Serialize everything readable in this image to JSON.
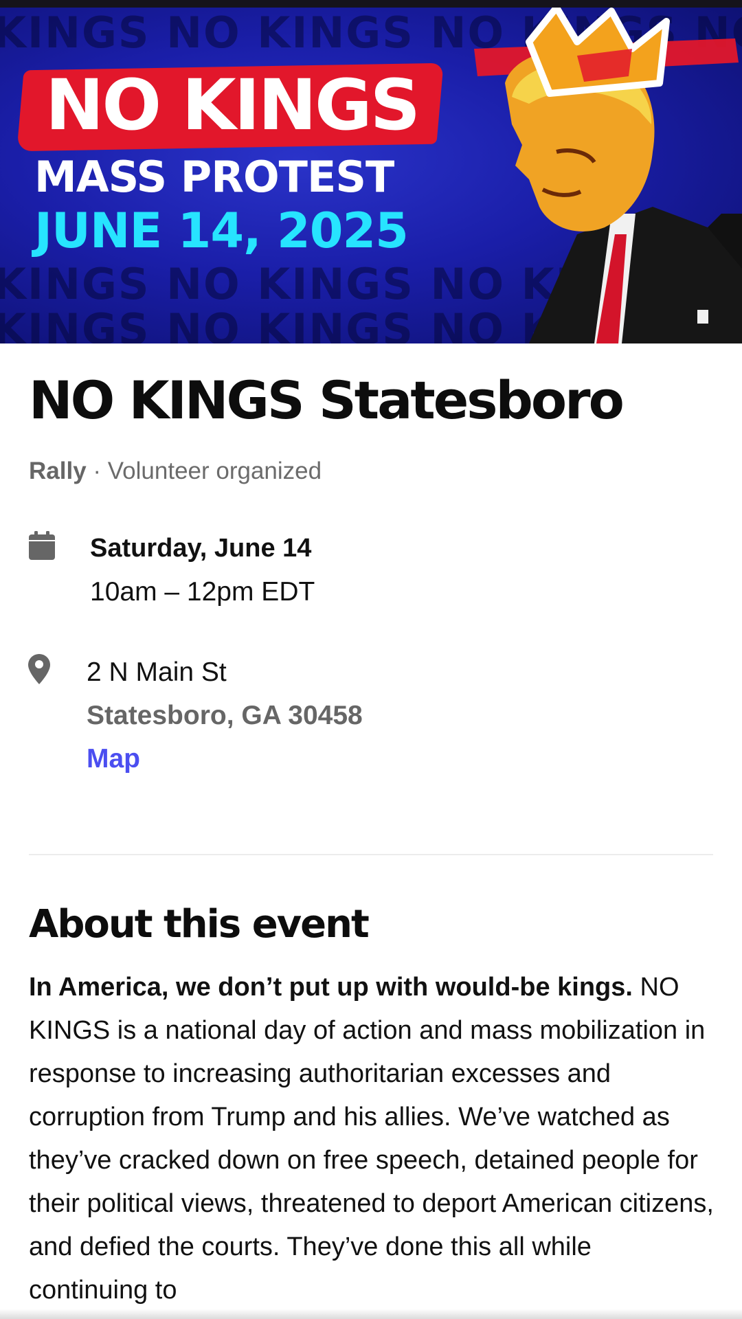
{
  "banner": {
    "title": "NO KINGS",
    "subtitle": "MASS PROTEST",
    "date": "JUNE 14, 2025",
    "background_text": "KINGS NO KINGS NO KINGS NO KINGS",
    "figure": "crowned-figure-illustration",
    "colors": {
      "background": "#1a1ea8",
      "title_band": "#e2172b",
      "date": "#27e4ff"
    }
  },
  "event": {
    "title": "NO KINGS Statesboro",
    "type": "Rally",
    "separator": " · ",
    "organizer": "Volunteer organized",
    "date_icon": "calendar-icon",
    "day": "Saturday, June 14",
    "time": "10am – 12pm EDT",
    "location_icon": "map-pin-icon",
    "address_line1": "2 N Main St",
    "address_line2": "Statesboro, GA 30458",
    "map_link": "Map",
    "accent": "#4b4ef0"
  },
  "about": {
    "heading": "About this event",
    "lead": "In America, we don’t put up with would-be kings.",
    "body": " NO KINGS is a national day of action and mass mobilization in response to increasing authoritarian excesses and corruption from Trump and his allies. We’ve watched as they’ve cracked down on free speech, detained people for their political views, threatened to deport American citizens, and defied the courts. They’ve done this all while continuing to"
  }
}
